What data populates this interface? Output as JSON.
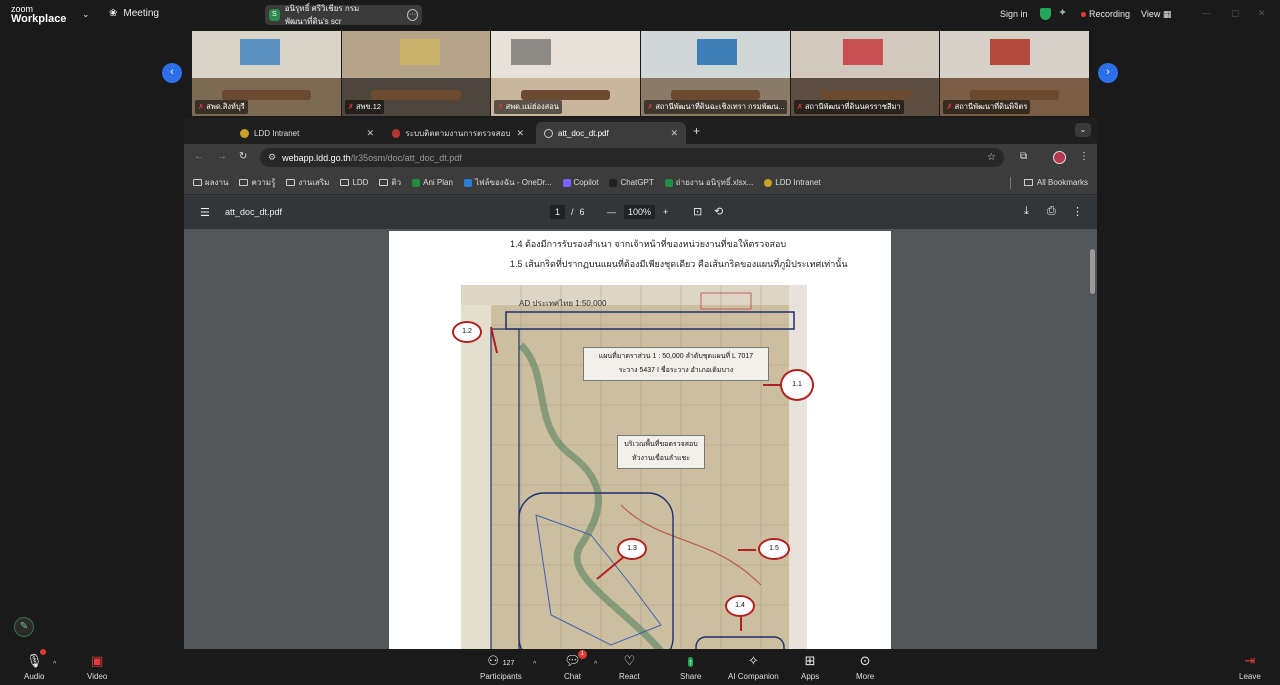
{
  "zoom": {
    "logo_line1": "zoom",
    "logo_line2": "Workplace",
    "meeting_label": "Meeting",
    "share_pill_label": "อนิรุทธิ์ ศรีวิเชียร กรมพัฒนาที่ดิน's scr",
    "sign_in": "Sign in",
    "recording": "Recording",
    "view": "View"
  },
  "participants": [
    {
      "name": "สพด.สิงห์บุรี",
      "wall": "#d9d4c8",
      "floor": "#7d6a52",
      "poster": "#5a8fc2"
    },
    {
      "name": "สพข.12",
      "wall": "#b5a48a",
      "floor": "#4e463c",
      "poster": "#c9b26a"
    },
    {
      "name": "สพด.แม่ฮ่องสอน",
      "wall": "#e6e2da",
      "floor": "#c8b79c",
      "poster": "#8e8a84"
    },
    {
      "name": "สถานีพัฒนาที่ดินฉะเชิงเทรา กรมพัฒน...",
      "wall": "#cfd8d6",
      "floor": "#8a7b66",
      "poster": "#3f7fb8"
    },
    {
      "name": "สถานีพัฒนาที่ดินนครราชสีมา",
      "wall": "#d2c8bd",
      "floor": "#5c4e40",
      "poster": "#c85050"
    },
    {
      "name": "สถานีพัฒนาที่ดินพิจิตร",
      "wall": "#d6d0c6",
      "floor": "#7a5d44",
      "poster": "#b5493e"
    }
  ],
  "browser": {
    "tabs": [
      {
        "label": "LDD Intranet"
      },
      {
        "label": "ระบบติดตามงานการตรวจสอบรา"
      },
      {
        "label": "att_doc_dt.pdf"
      }
    ],
    "url_host": "webapp.ldd.go.th",
    "url_path": "/lr35osm/doc/att_doc_dt.pdf",
    "bookmarks": [
      {
        "label": "ผลงาน",
        "kind": "folder"
      },
      {
        "label": "ความรู้",
        "kind": "folder"
      },
      {
        "label": "งานเสริม",
        "kind": "folder"
      },
      {
        "label": "LDD",
        "kind": "folder"
      },
      {
        "label": "ติว",
        "kind": "folder"
      },
      {
        "label": "Ani Plan",
        "kind": "sheet",
        "color": "#1e8e3e"
      },
      {
        "label": "ไฟล์ของฉัน - OneDr...",
        "kind": "sheet",
        "color": "#2b7cd3"
      },
      {
        "label": "Copilot",
        "kind": "sheet",
        "color": "#7b61ff"
      },
      {
        "label": "ChatGPT",
        "kind": "sheet",
        "color": "#202020"
      },
      {
        "label": "ถ่ายงาน อนิรุทธิ์.xlsx...",
        "kind": "sheet",
        "color": "#1e8e3e"
      },
      {
        "label": "LDD Intranet",
        "kind": "sheet",
        "color": "#c9a227"
      }
    ],
    "all_bookmarks": "All Bookmarks"
  },
  "pdf": {
    "filename": "att_doc_dt.pdf",
    "page_current": "1",
    "page_total": "6",
    "zoom": "100%",
    "line_1_4": "1.4 ต้องมีการรับรองสำเนา จากเจ้าหน้าที่ของหน่วยงานที่ขอให้ตรวจสอบ",
    "line_1_5": "1.5 เส้นกริดที่ปรากฏบนแผนที่ต้องมีเพียงชุดเดียว คือเส้นกริดของแผนที่ภูมิประเทศเท่านั้น",
    "map_header": "AD ประเทศไทย 1:50,000",
    "map_box_line1": "แผนที่มาตราส่วน 1 : 50,000  ลำดับชุดแผนที่  L 7017",
    "map_box_line2": "ระวาง 5437 I  ชื่อระวาง อำเภอเดิมบาง",
    "map_box2_line1": "บริเวณพื้นที่ขอตรวจสอบ",
    "map_box2_line2": "หัวงานเขื่อนลำแชะ",
    "callouts": [
      "1.2",
      "1.1",
      "1.3",
      "1.5",
      "1.4"
    ]
  },
  "bottom_bar": {
    "audio": "Audio",
    "video": "Video",
    "participants": "Participants",
    "participant_count": "127",
    "chat": "Chat",
    "chat_badge": "1",
    "react": "React",
    "share": "Share",
    "ai_companion": "AI Companion",
    "apps": "Apps",
    "more": "More",
    "leave": "Leave"
  }
}
